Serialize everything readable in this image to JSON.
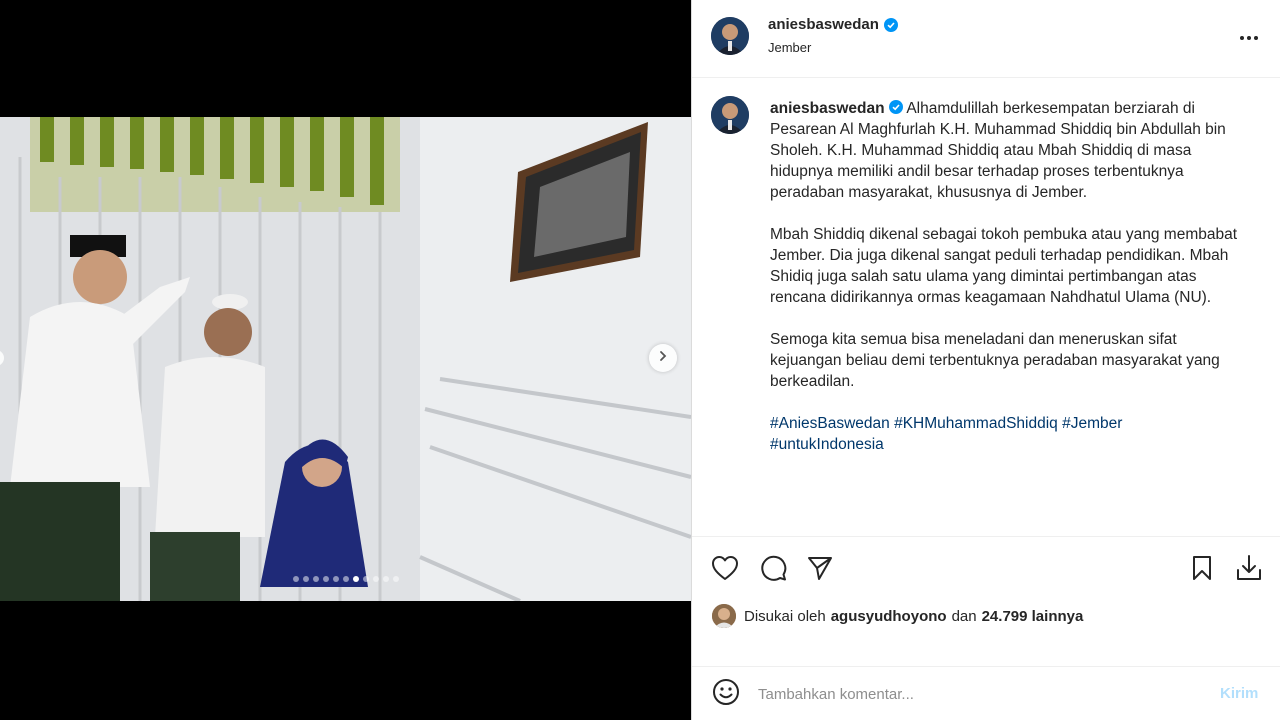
{
  "header": {
    "username": "aniesbaswedan",
    "location": "Jember",
    "more_icon": "more-horizontal-icon"
  },
  "media": {
    "slide_count": 11,
    "active_slide": 6
  },
  "caption": {
    "username": "aniesbaswedan",
    "paragraph1": "Alhamdulillah berkesempatan berziarah di Pesarean Al Maghfurlah K.H. Muhammad Shiddiq bin Abdullah bin Sholeh. K.H. Muhammad Shiddiq atau Mbah Shiddiq di masa hidupnya memiliki andil besar terhadap proses terbentuknya peradaban masyarakat, khususnya di Jember.",
    "paragraph2": "Mbah Shiddiq dikenal sebagai tokoh pembuka atau yang membabat Jember. Dia juga dikenal sangat peduli terhadap pendidikan. Mbah Shidiq juga salah satu ulama yang dimintai pertimbangan atas rencana didirikannya ormas keagamaan Nahdhatul Ulama (NU).",
    "paragraph3": "Semoga kita semua bisa meneladani dan meneruskan sifat kejuangan beliau demi terbentuknya peradaban masyarakat yang berkeadilan.",
    "hashtags": [
      "#AniesBaswedan",
      "#KHMuhammadShiddiq",
      "#Jember",
      "#untukIndonesia"
    ]
  },
  "likes": {
    "prefix": "Disukai oleh",
    "user": "agusyudhoyono",
    "connector": "dan",
    "count": "24.799 lainnya"
  },
  "comment": {
    "placeholder": "Tambahkan komentar...",
    "post_label": "Kirim"
  },
  "colors": {
    "verified": "#0095f6",
    "hashtag": "#00376b",
    "post_disabled": "#b2dffc"
  }
}
